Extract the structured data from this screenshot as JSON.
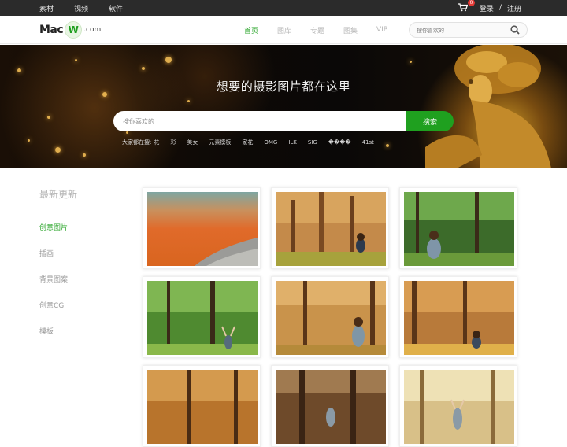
{
  "topbar": {
    "links": [
      "素材",
      "视频",
      "软件"
    ],
    "cart_count": "0",
    "login": "登录",
    "separator": "/",
    "register": "注册"
  },
  "logo": {
    "left": "Mac",
    "mark": "W",
    "suffix": ".com"
  },
  "nav": {
    "links": [
      {
        "label": "首页",
        "active": true
      },
      {
        "label": "图库",
        "active": false
      },
      {
        "label": "专题",
        "active": false
      },
      {
        "label": "图集",
        "active": false
      },
      {
        "label": "VIP",
        "active": false
      }
    ],
    "search_placeholder": "搜你喜欢的"
  },
  "hero": {
    "title": "想要的摄影图片都在这里",
    "search_placeholder": "搜你喜欢的",
    "search_button": "搜索",
    "tags_label": "大家都在搜:",
    "tags": [
      "花",
      "彩",
      "美女",
      "元素模板",
      "家花",
      "OMG",
      "ILK",
      "SIG",
      "����",
      "41st"
    ]
  },
  "sidebar": {
    "title": "最新更新",
    "items": [
      {
        "label": "创意图片",
        "active": true
      },
      {
        "label": "插画",
        "active": false
      },
      {
        "label": "背景图案",
        "active": false
      },
      {
        "label": "创意CG",
        "active": false
      },
      {
        "label": "模板",
        "active": false
      }
    ]
  },
  "colors": {
    "accent": "#2aa52a",
    "topbar": "#2b2b2b",
    "search_button": "#1fa01f",
    "badge": "#e53935"
  },
  "grid": {
    "cards": [
      {
        "name": "orange-lake-photo"
      },
      {
        "name": "autumn-forest-girl-photo"
      },
      {
        "name": "green-forest-girl-photo"
      },
      {
        "name": "green-forest-arms-up-photo"
      },
      {
        "name": "autumn-forest-walking-photo"
      },
      {
        "name": "autumn-forest-sitting-photo"
      },
      {
        "name": "autumn-trees-arms-up-photo"
      },
      {
        "name": "dark-forest-standing-photo"
      },
      {
        "name": "sunlit-forest-dancing-photo"
      }
    ]
  }
}
